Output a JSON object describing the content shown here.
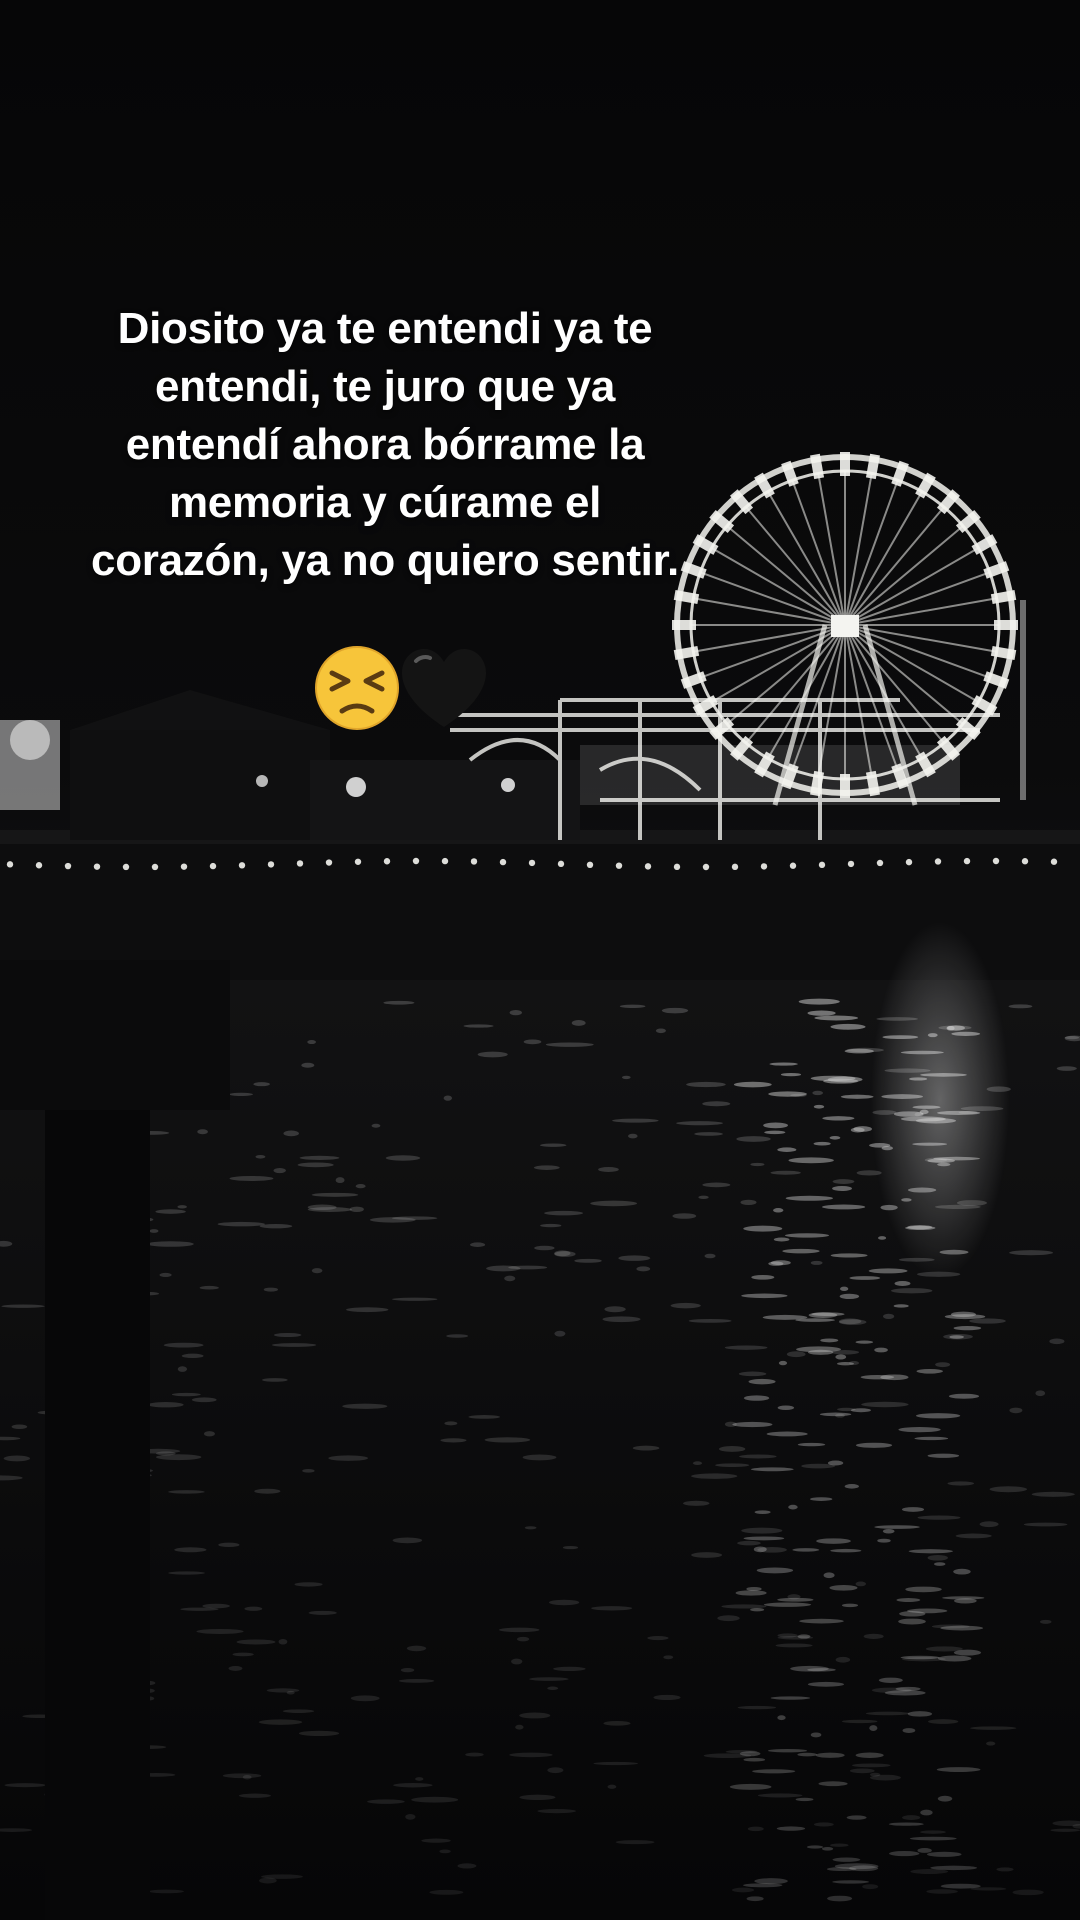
{
  "caption": {
    "lines": [
      "Diosito ya te entendi ya te",
      "entendi, te juro que ya",
      "entendí ahora bórrame la",
      "memoria y cúrame el",
      "corazón, ya no quiero sentir."
    ]
  },
  "emojis": [
    {
      "name": "persevering-face-emoji",
      "glyph": "😣"
    },
    {
      "name": "black-heart-emoji",
      "glyph": "🖤"
    }
  ],
  "colors": {
    "text": "#ffffff",
    "background": "#050506",
    "lights": "#f4f4f0",
    "emoji_face": "#f7c53a",
    "heart": "#141414"
  }
}
